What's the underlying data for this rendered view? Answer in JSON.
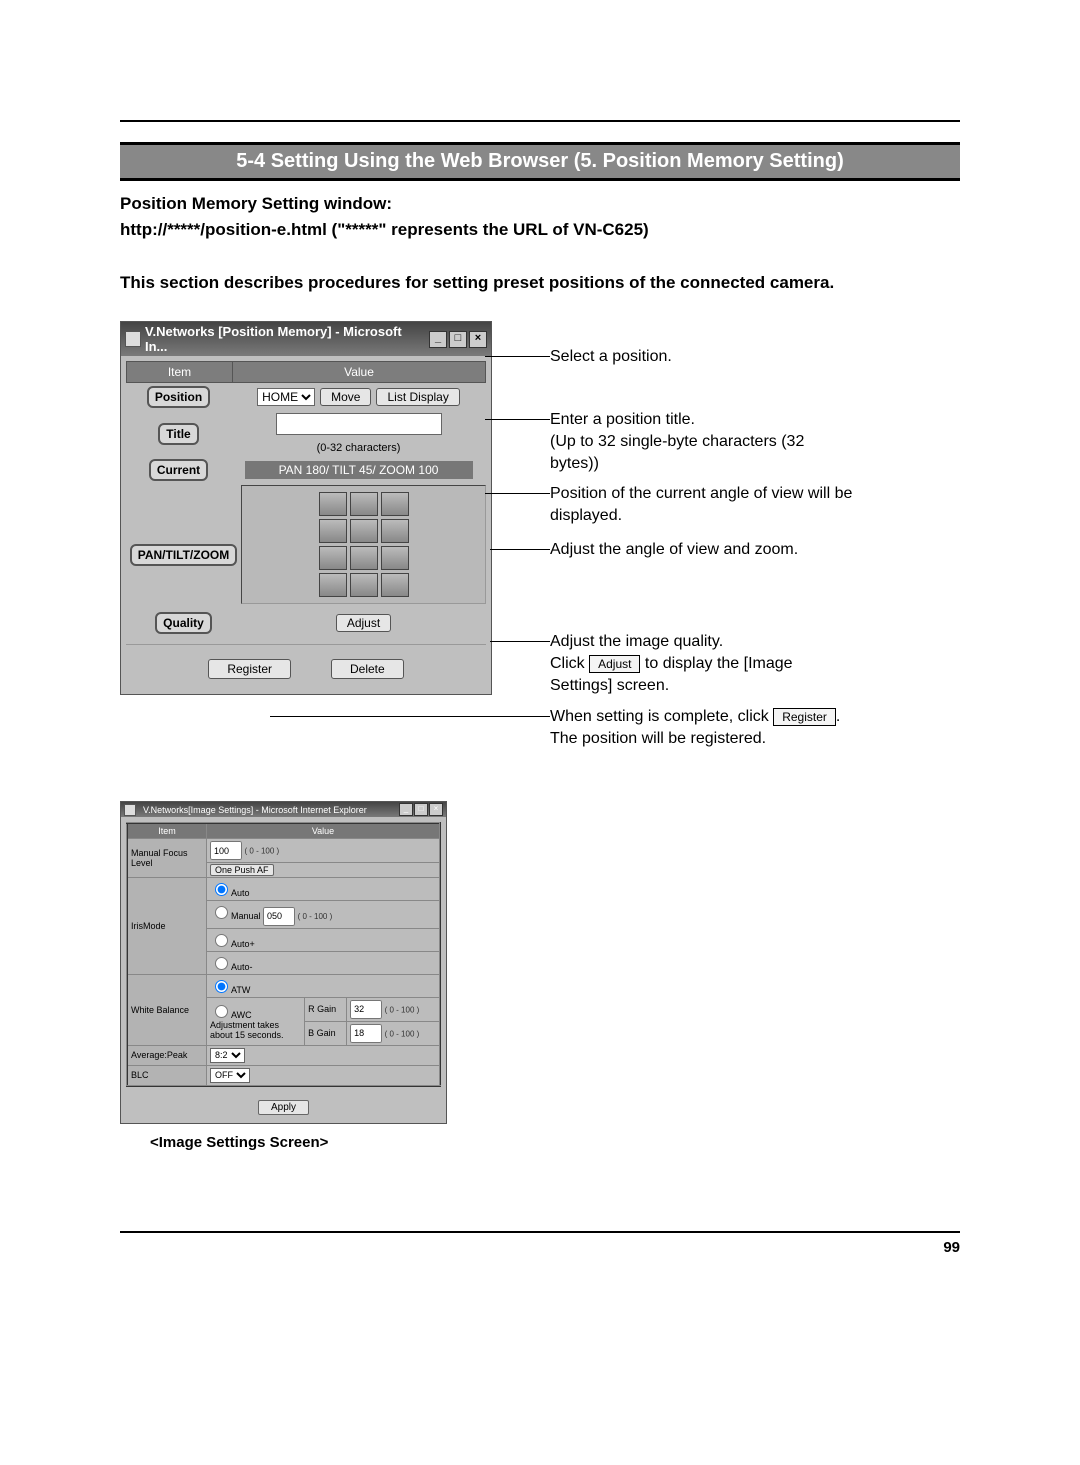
{
  "section_title": "5-4 Setting Using the Web Browser (5. Position Memory Setting)",
  "intro": {
    "line1": "Position Memory Setting window:",
    "line2": "http://*****/position-e.html (\"*****\" represents the URL of VN-C625)",
    "line3": "This section describes procedures for setting preset positions of the connected camera."
  },
  "window1": {
    "title": "V.Networks [Position Memory] - Microsoft In...",
    "hdr_item": "Item",
    "hdr_value": "Value",
    "position_label": "Position",
    "position_sel": "HOME",
    "move_btn": "Move",
    "list_btn": "List Display",
    "title_label": "Title",
    "char_note": "(0-32 characters)",
    "current_label": "Current",
    "current_value": "PAN 180/ TILT 45/ ZOOM 100",
    "ptz_label": "PAN/TILT/ZOOM",
    "quality_label": "Quality",
    "adjust_btn": "Adjust",
    "register_btn": "Register",
    "delete_btn": "Delete"
  },
  "callouts": {
    "c1": "Select a position.",
    "c2a": "Enter a position title.",
    "c2b": "(Up to 32 single-byte characters (32 bytes))",
    "c3": "Position of the current angle of view will be displayed.",
    "c4": "Adjust the angle of view and zoom.",
    "c5a": "Adjust the image quality.",
    "c5b_pre": "Click ",
    "c5b_btn": "Adjust",
    "c5b_post": " to display the [Image Settings] screen.",
    "c6a_pre": "When setting is complete, click ",
    "c6a_btn": "Register",
    "c6a_post": ".",
    "c6b": "The position will be registered."
  },
  "window2": {
    "title": "V.Networks[Image Settings] - Microsoft Internet Explorer",
    "hdr_item": "Item",
    "hdr_value": "Value",
    "mfl_label": "Manual Focus Level",
    "mfl_value": "100",
    "onepush_btn": "One Push AF",
    "iris_label": "IrisMode",
    "iris_auto": "Auto",
    "iris_manual": "Manual",
    "iris_manual_val": "050",
    "iris_autop": "Auto+",
    "iris_autom": "Auto-",
    "wb_label": "White Balance",
    "wb_atw": "ATW",
    "wb_awc": "AWC",
    "wb_note1": "Adjustment takes",
    "wb_note2": "about 15 seconds.",
    "rgain": "R Gain",
    "bgain": "B Gain",
    "rgain_val": "32",
    "bgain_val": "18",
    "range": "( 0 - 100 )",
    "avgpeak_label": "Average:Peak",
    "avgpeak_val": "8:2",
    "blc_label": "BLC",
    "blc_val": "OFF",
    "apply_btn": "Apply"
  },
  "img_caption": "<Image Settings Screen>",
  "page_number": "99"
}
